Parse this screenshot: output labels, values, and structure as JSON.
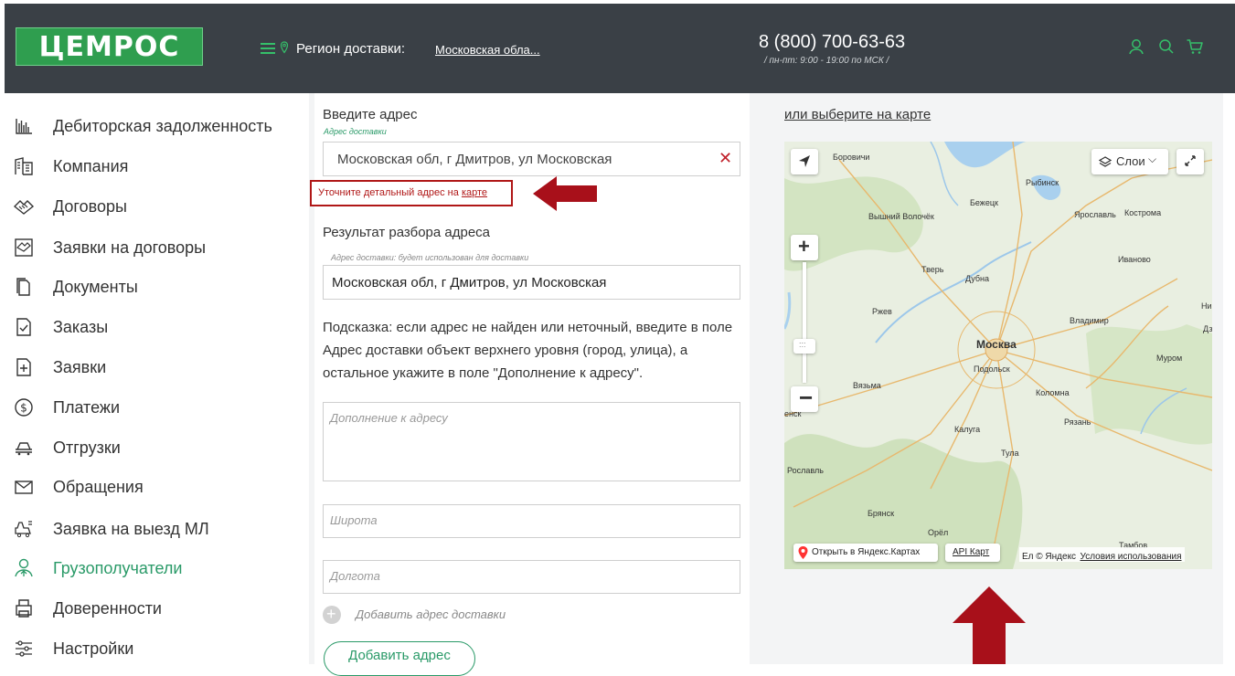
{
  "header": {
    "logo_text": "ЦЕМРОС",
    "region_label": "Регион доставки:",
    "region_value": "Московская обла...",
    "phone": "8 (800) 700-63-63",
    "hours": "/ пн-пт: 9:00 - 19:00 по МСК /",
    "accent_color": "#35c06a",
    "bg_color": "#3a4046"
  },
  "sidebar": {
    "items": [
      {
        "label": "Дебиторская задолженность",
        "icon": "bar-chart-icon"
      },
      {
        "label": "Компания",
        "icon": "building-icon"
      },
      {
        "label": "Договоры",
        "icon": "handshake-icon"
      },
      {
        "label": "Заявки на договоры",
        "icon": "contract-request-icon"
      },
      {
        "label": "Документы",
        "icon": "document-icon"
      },
      {
        "label": "Заказы",
        "icon": "order-icon"
      },
      {
        "label": "Заявки",
        "icon": "request-icon"
      },
      {
        "label": "Платежи",
        "icon": "payment-icon"
      },
      {
        "label": "Отгрузки",
        "icon": "truck-icon"
      },
      {
        "label": "Обращения",
        "icon": "mail-icon"
      },
      {
        "label": "Заявка на выезд МЛ",
        "icon": "vehicle-icon"
      },
      {
        "label": "Грузополучатели",
        "icon": "recipient-icon"
      },
      {
        "label": "Доверенности",
        "icon": "printer-icon"
      },
      {
        "label": "Настройки",
        "icon": "settings-icon"
      }
    ],
    "active_index": 11,
    "active_color": "#2a9a68"
  },
  "form": {
    "address_title": "Введите адрес",
    "address_caption": "Адрес доставки",
    "address_value": "Московская обл, г Дмитров, ул Московская",
    "error_text": "Уточните детальный адрес на ",
    "error_link": "карте",
    "result_title": "Результат разбора адреса",
    "result_caption": "Адрес доставки: будет использован для доставки",
    "result_value": "Московская обл, г Дмитров, ул Московская",
    "hint_line1": "Подсказка: если адрес не найден или неточный, введите в поле",
    "hint_line2": "Адрес доставки объект верхнего уровня (город, улица), а",
    "hint_line3": "остальное укажите в поле \"Дополнение к адресу\".",
    "supplement_placeholder": "Дополнение к адресу",
    "latitude_placeholder": "Широта",
    "longitude_placeholder": "Долгота",
    "add_delivery_label": "Добавить адрес доставки",
    "add_address_button": "Добавить адрес",
    "error_color": "#b01717"
  },
  "map": {
    "choose_link": "или выберите на карте",
    "layers_label": "Слои",
    "open_yandex": "Открыть в Яндекс.Картах",
    "api_label": "API Карт",
    "copyright": "Ел © Яндекс",
    "terms": "Условия использования",
    "cities": {
      "borovichi": "Боровичи",
      "rybinsk": "Рыбинск",
      "bezhetsk": "Бежецк",
      "vyshniy": "Вышний Волочёк",
      "yaroslavl": "Ярославль",
      "kostroma": "Кострома",
      "ivanovo": "Иваново",
      "tver": "Тверь",
      "dubna": "Дубна",
      "rzhev": "Ржев",
      "vladimir": "Владимир",
      "moskva": "Москва",
      "podolsk": "Подольск",
      "murom": "Муром",
      "vyazma": "Вязьма",
      "kolomna": "Коломна",
      "ryazan": "Рязань",
      "kaluga": "Калуга",
      "tula": "Тула",
      "roslavl": "Рославль",
      "bryansk": "Брянск",
      "orel": "Орёл",
      "ensk": "енск",
      "ni": "Ни",
      "dz": "Дз",
      "tambov": "Тамбов"
    }
  }
}
